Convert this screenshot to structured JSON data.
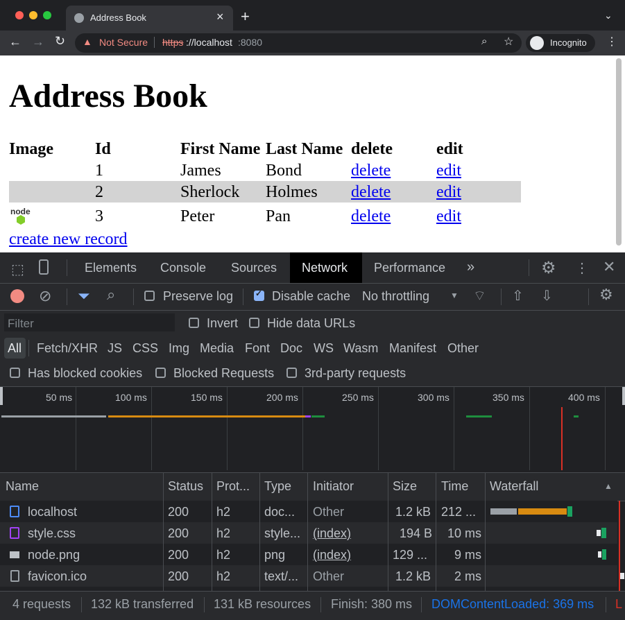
{
  "browser": {
    "tab_title": "Address Book",
    "new_tab": "+",
    "not_secure": "Not Secure",
    "url_scheme": "https",
    "url_rest": "://localhost",
    "url_port": ":8080",
    "incognito": "Incognito"
  },
  "page": {
    "heading": "Address Book",
    "table_headers": [
      "Image",
      "Id",
      "First Name",
      "Last Name",
      "delete",
      "edit"
    ],
    "rows": [
      {
        "image": "",
        "id": "1",
        "first": "James",
        "last": "Bond",
        "delete": "delete",
        "edit": "edit"
      },
      {
        "image": "",
        "id": "2",
        "first": "Sherlock",
        "last": "Holmes",
        "delete": "delete",
        "edit": "edit"
      },
      {
        "image": "node",
        "id": "3",
        "first": "Peter",
        "last": "Pan",
        "delete": "delete",
        "edit": "edit"
      }
    ],
    "create_link": "create new record"
  },
  "devtools": {
    "tabs": [
      "Elements",
      "Console",
      "Sources",
      "Network",
      "Performance"
    ],
    "active_tab": "Network",
    "more": "»",
    "preserve_log": "Preserve log",
    "disable_cache": "Disable cache",
    "throttling": "No throttling",
    "filter_placeholder": "Filter",
    "invert": "Invert",
    "hide_data_urls": "Hide data URLs",
    "type_filters": [
      "All",
      "Fetch/XHR",
      "JS",
      "CSS",
      "Img",
      "Media",
      "Font",
      "Doc",
      "WS",
      "Wasm",
      "Manifest",
      "Other"
    ],
    "has_blocked_cookies": "Has blocked cookies",
    "blocked_requests": "Blocked Requests",
    "third_party": "3rd-party requests",
    "overview_ticks": [
      "50 ms",
      "100 ms",
      "150 ms",
      "200 ms",
      "250 ms",
      "300 ms",
      "350 ms",
      "400 ms"
    ],
    "columns": [
      "Name",
      "Status",
      "Prot...",
      "Type",
      "Initiator",
      "Size",
      "Time",
      "Waterfall"
    ],
    "requests": [
      {
        "name": "localhost",
        "icon": "document-icon",
        "status": "200",
        "protocol": "h2",
        "type": "doc...",
        "initiator": "Other",
        "size": "1.2 kB",
        "time": "212 ..."
      },
      {
        "name": "style.css",
        "icon": "stylesheet-icon",
        "status": "200",
        "protocol": "h2",
        "type": "style...",
        "initiator": "(index)",
        "size": "194 B",
        "time": "10 ms"
      },
      {
        "name": "node.png",
        "icon": "image-icon",
        "status": "200",
        "protocol": "h2",
        "type": "png",
        "initiator": "(index)",
        "size": "129 ...",
        "time": "9 ms"
      },
      {
        "name": "favicon.ico",
        "icon": "file-icon",
        "status": "200",
        "protocol": "h2",
        "type": "text/...",
        "initiator": "Other",
        "size": "1.2 kB",
        "time": "2 ms"
      }
    ],
    "summary": {
      "requests": "4 requests",
      "transferred": "132 kB transferred",
      "resources": "131 kB resources",
      "finish": "Finish: 380 ms",
      "dcl": "DOMContentLoaded: 369 ms",
      "load": "L"
    },
    "colors": {
      "dcl": "#1a73e8",
      "load": "#d93025",
      "active_tab_bg": "#000000",
      "accent": "#8ab4f8"
    }
  }
}
